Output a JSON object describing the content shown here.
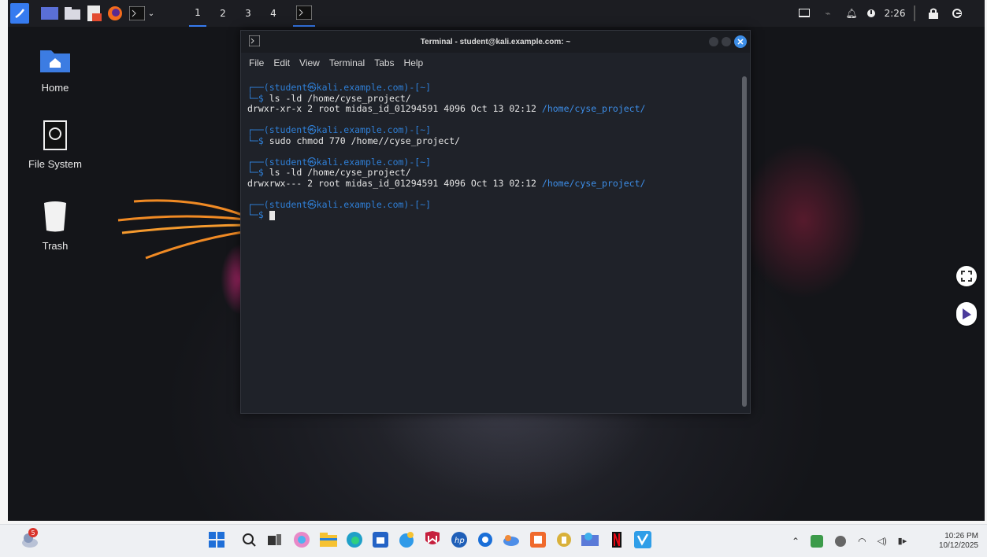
{
  "kali_panel": {
    "workspaces": [
      "1",
      "2",
      "3",
      "4"
    ],
    "clock": "2:26"
  },
  "desktop_icons": [
    {
      "label": "Home",
      "icon": "home-folder-icon"
    },
    {
      "label": "File System",
      "icon": "drive-icon"
    },
    {
      "label": "Trash",
      "icon": "trash-icon"
    }
  ],
  "terminal": {
    "title": "Terminal - student@kali.example.com: ~",
    "menu": [
      "File",
      "Edit",
      "View",
      "Terminal",
      "Tabs",
      "Help"
    ],
    "prompt": "┌──(student㉿kali.example.com)-[~]",
    "prompt_marker": "└─$",
    "cmd1": "ls -ld /home/cyse_project/",
    "out1_prefix": "drwxr-xr-x 2 root midas_id_01294591 4096 Oct 13 02:12",
    "out1_path": "/home/cyse_project/",
    "cmd2": "sudo chmod 770 /home//cyse_project/",
    "cmd3": "ls -ld /home/cyse_project/",
    "out3_prefix": "drwxrwx--- 2 root midas_id_01294591 4096 Oct 13 02:12",
    "out3_path": "/home/cyse_project/"
  },
  "taskbar": {
    "time": "10:26 PM",
    "date": "10/12/2025",
    "notification_badge": "5"
  },
  "colors": {
    "accent": "#2f7fd6",
    "terminal_bg": "#1f2229",
    "taskbar_bg": "#eef0f3"
  }
}
